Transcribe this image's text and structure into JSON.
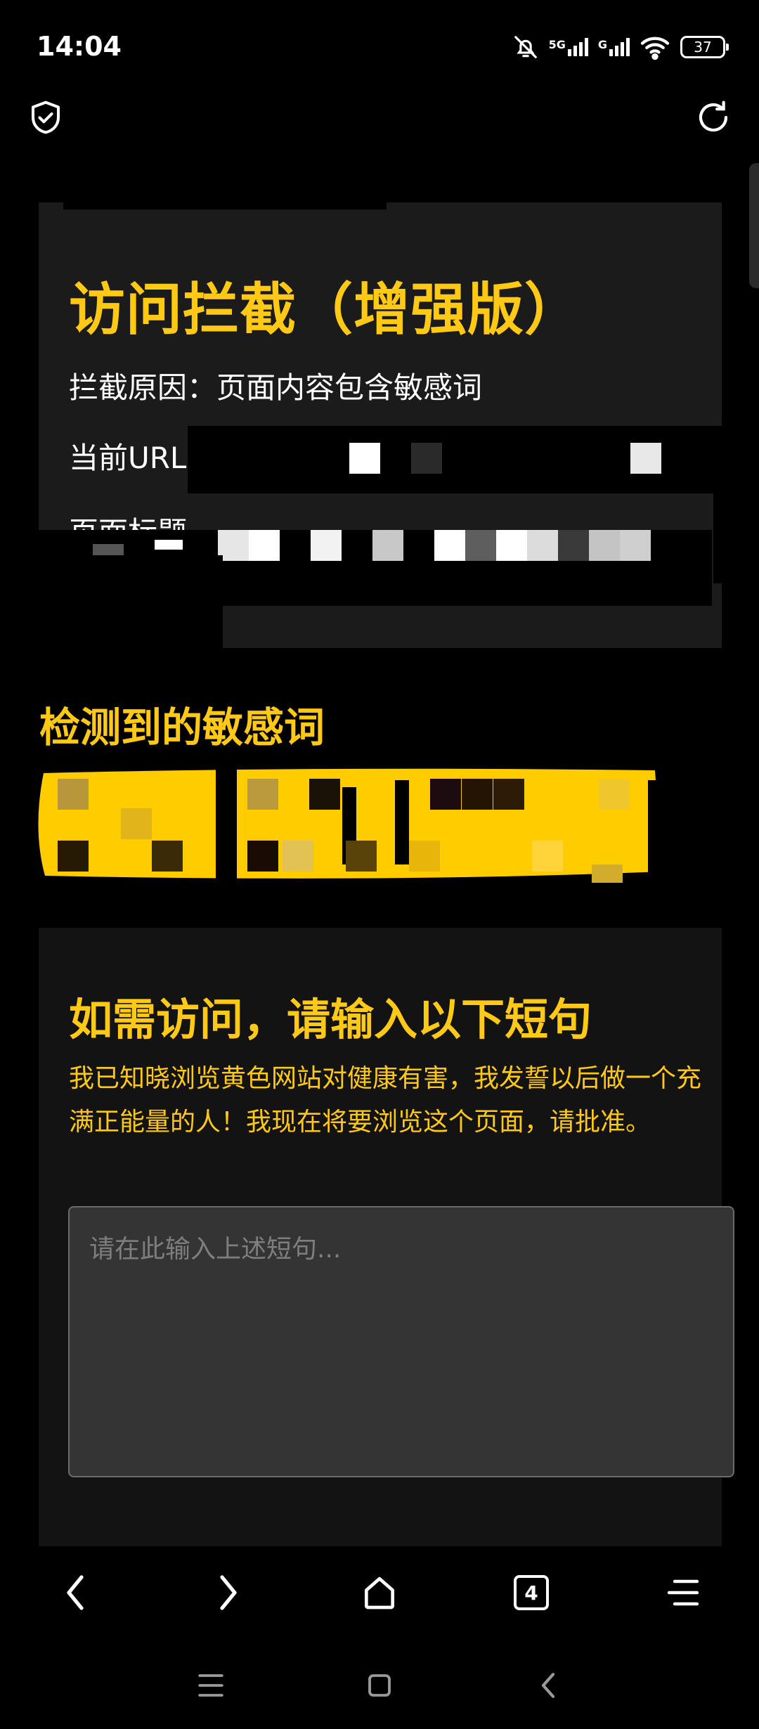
{
  "status_bar": {
    "time": "14:04",
    "network_1": "5G",
    "network_2": "G",
    "battery": "37"
  },
  "toolbar": {
    "shield_icon": "shield-check-icon",
    "refresh_icon": "refresh-icon"
  },
  "block_card": {
    "title": "访问拦截（增强版）",
    "reason_label": "拦截原因：",
    "reason_value": "页面内容包含敏感词",
    "url_label": "当前URL",
    "page_title_label": "页面标题"
  },
  "sensitive": {
    "heading": "检测到的敏感词"
  },
  "confirm_card": {
    "title": "如需访问，请输入以下短句",
    "pledge": "我已知晓浏览黄色网站对健康有害，我发誓以后做一个充满正能量的人！我现在将要浏览这个页面，请批准。",
    "input_placeholder": "请在此输入上述短句..."
  },
  "browser_nav": {
    "tab_count": "4",
    "icons": [
      "back-icon",
      "forward-icon",
      "home-icon",
      "tabs-icon",
      "menu-icon"
    ]
  },
  "system_nav": {
    "icons": [
      "recents-icon",
      "home-square-icon",
      "system-back-icon"
    ]
  },
  "colors": {
    "accent": "#ffc916",
    "card_bg": "#1b1b1b",
    "input_bg": "#343434"
  }
}
